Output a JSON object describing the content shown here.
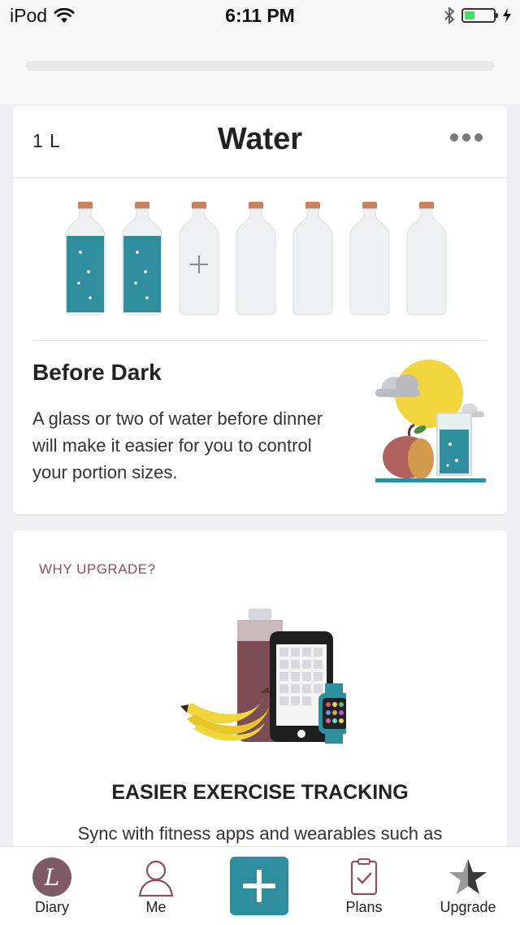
{
  "status_bar": {
    "carrier": "iPod",
    "time": "6:11 PM"
  },
  "water_card": {
    "amount": "1 L",
    "title": "Water",
    "bottles": [
      {
        "state": "filled"
      },
      {
        "state": "filled"
      },
      {
        "state": "add"
      },
      {
        "state": "empty"
      },
      {
        "state": "empty"
      },
      {
        "state": "empty"
      },
      {
        "state": "empty"
      }
    ],
    "tip": {
      "title": "Before Dark",
      "body": "A glass or two of water before dinner will make it easier for you to control your portion sizes."
    }
  },
  "upgrade_card": {
    "label": "WHY UPGRADE?",
    "title": "EASIER EXERCISE TRACKING",
    "body": "Sync with fitness apps and wearables such as"
  },
  "tab_bar": {
    "items": [
      {
        "label": "Diary",
        "icon": "diary-logo-icon"
      },
      {
        "label": "Me",
        "icon": "person-icon"
      },
      {
        "label": "",
        "icon": "plus-icon"
      },
      {
        "label": "Plans",
        "icon": "clipboard-icon"
      },
      {
        "label": "Upgrade",
        "icon": "star-icon"
      }
    ]
  },
  "colors": {
    "accent": "#2e8e9d",
    "water": "#2e8e9d",
    "upgrade_label": "#8b4f5d",
    "sun": "#f0d53c",
    "apple": "#b0625f"
  }
}
